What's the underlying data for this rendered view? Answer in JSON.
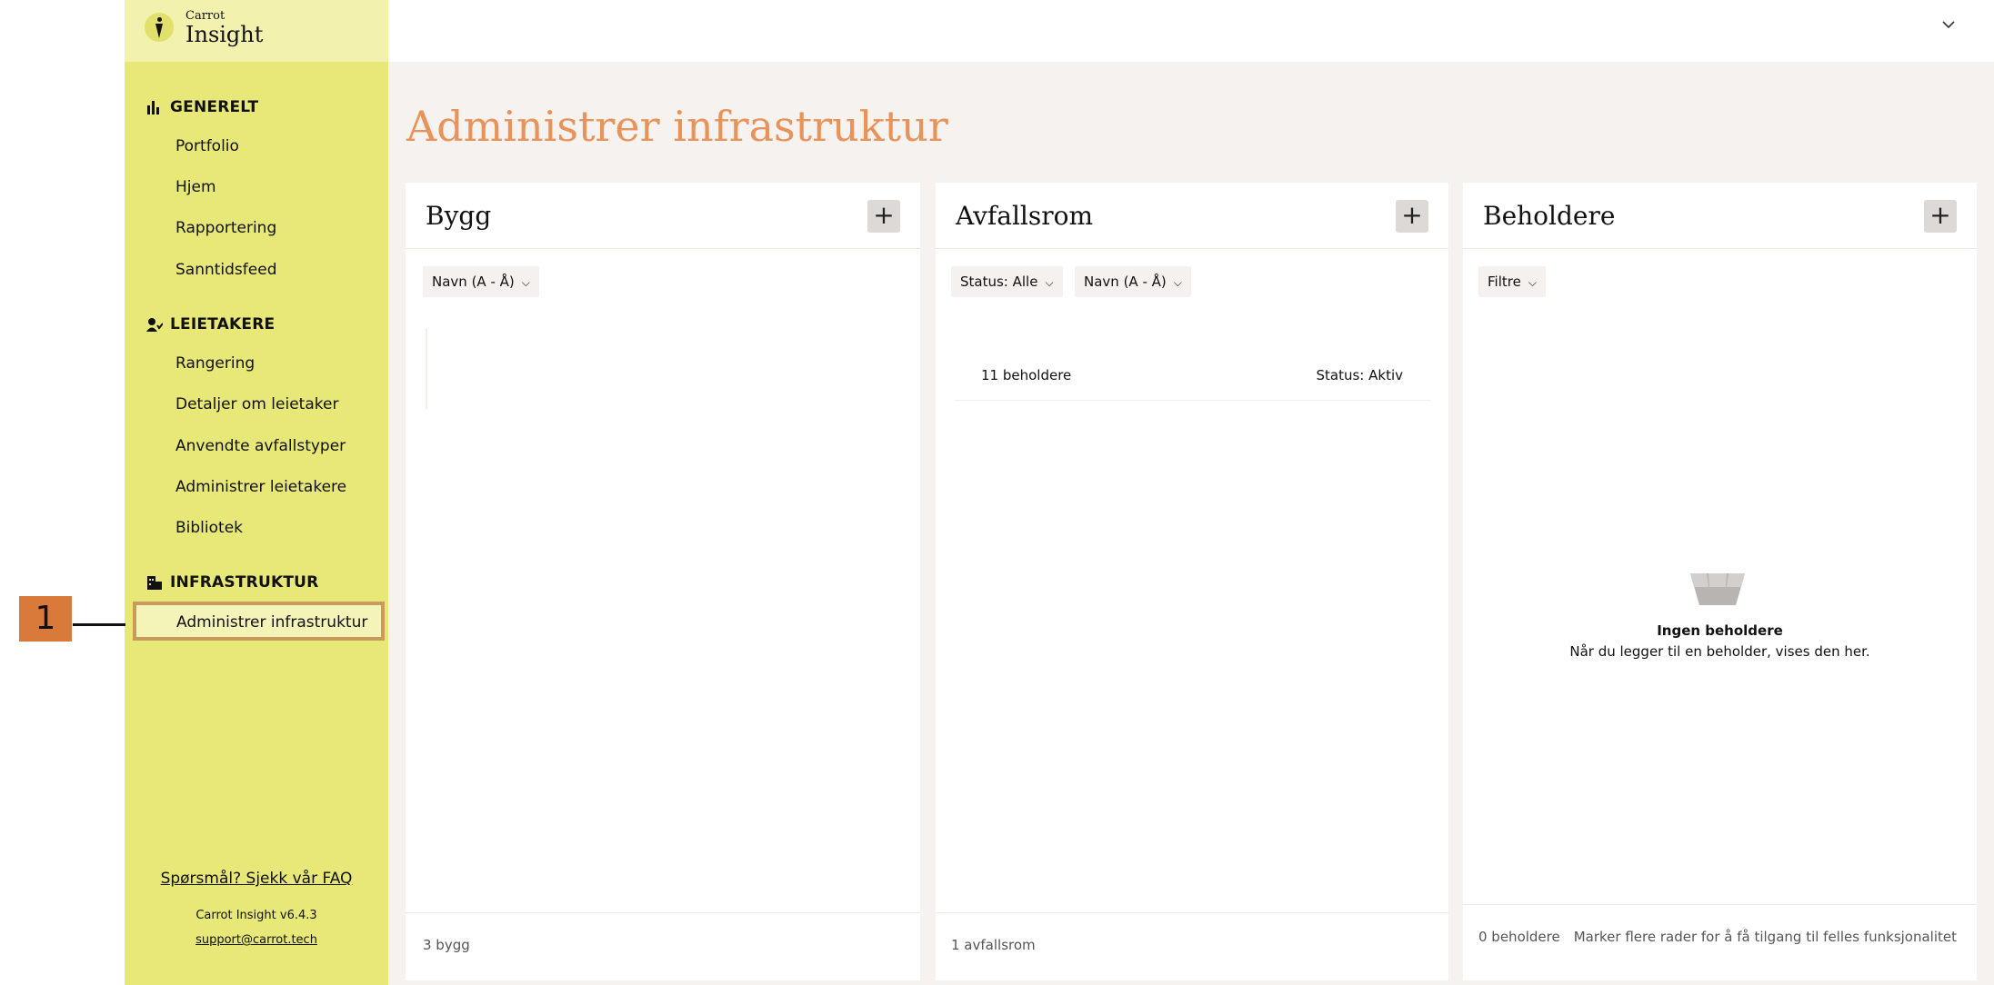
{
  "logo": {
    "small": "Carrot",
    "main": "Insight"
  },
  "sidebar": {
    "sections": [
      {
        "title": "GENERELT",
        "icon": "bar-chart-icon",
        "items": [
          "Portfolio",
          "Hjem",
          "Rapportering",
          "Sanntidsfeed"
        ]
      },
      {
        "title": "LEIETAKERE",
        "icon": "users-icon",
        "items": [
          "Rangering",
          "Detaljer om leietaker",
          "Anvendte avfallstyper",
          "Administrer leietakere",
          "Bibliotek"
        ]
      },
      {
        "title": "INFRASTRUKTUR",
        "icon": "building-icon",
        "items": [
          "Administrer infrastruktur"
        ]
      }
    ],
    "faq": "Spørsmål? Sjekk vår FAQ",
    "version": "Carrot Insight v6.4.3",
    "support": "support@carrot.tech"
  },
  "annotation": {
    "marker": "1"
  },
  "page": {
    "title": "Administrer infrastruktur"
  },
  "panels": {
    "bygg": {
      "title": "Bygg",
      "filters": [
        "Navn (A - Å)"
      ],
      "footer": "3 bygg"
    },
    "avfallsrom": {
      "title": "Avfallsrom",
      "filters": [
        "Status: Alle",
        "Navn (A - Å)"
      ],
      "rows": [
        {
          "left": "11 beholdere",
          "right": "Status: Aktiv"
        }
      ],
      "footer": "1 avfallsrom"
    },
    "beholdere": {
      "title": "Beholdere",
      "filters": [
        "Filtre"
      ],
      "empty_title": "Ingen beholdere",
      "empty_sub": "Når du legger til en beholder, vises den her.",
      "footer_count": "0 beholdere",
      "footer_hint": "Marker flere rader for å få tilgang til felles funksjonalitet"
    }
  },
  "colors": {
    "sidebar": "#e8e878",
    "accent_title": "#e8935a",
    "marker": "#d9793a"
  }
}
